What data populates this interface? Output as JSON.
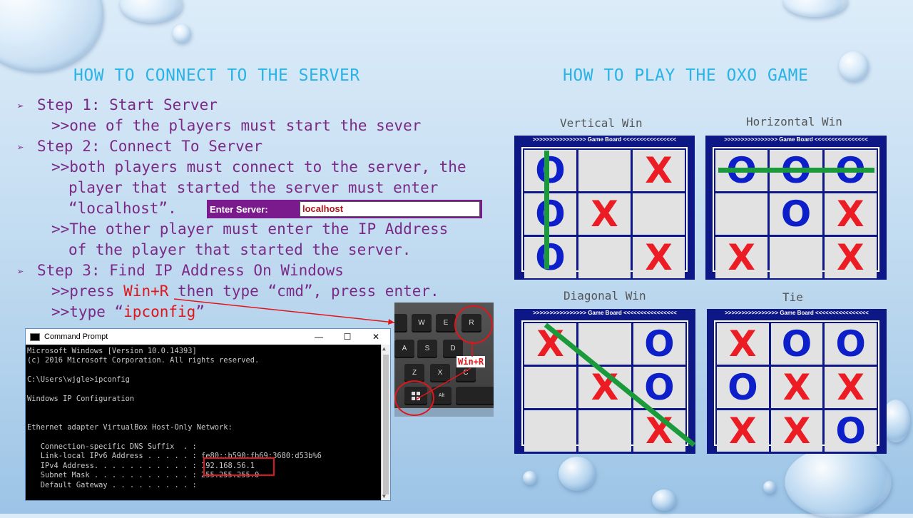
{
  "headings": {
    "connect": "HOW TO CONNECT TO THE SERVER",
    "play": "HOW TO PLAY THE OXO GAME"
  },
  "steps": {
    "bullet": "➢",
    "step1": "Step 1: Start Server",
    "step1_detail": ">>one of the players must start the sever",
    "step2": "Step 2: Connect To Server",
    "step2_detail_1": ">>both players must connect to the server, the",
    "step2_detail_2": "player that started the server must enter",
    "step2_detail_3": "“localhost”.",
    "step2_detail_4": ">>The other player must enter the IP Address",
    "step2_detail_5": "of the player that started the server.",
    "step3": "Step 3: Find IP Address On Windows",
    "step3_press_pre": ">>press ",
    "step3_press_key": "Win+R",
    "step3_press_post": " then type “cmd”, press enter.",
    "step3_type_pre": ">>type “",
    "step3_type_cmd": "ipconfig",
    "step3_type_post": "”"
  },
  "enter_server": {
    "label": "Enter Server:",
    "value": "localhost"
  },
  "cmd": {
    "title": "Command Prompt",
    "controls": {
      "minimize": "—",
      "maximize": "☐",
      "close": "✕"
    },
    "lines": [
      "Microsoft Windows [Version 10.0.14393]",
      "(c) 2016 Microsoft Corporation. All rights reserved.",
      "",
      "C:\\Users\\wjgle>ipconfig",
      "",
      "Windows IP Configuration",
      "",
      "",
      "Ethernet adapter VirtualBox Host-Only Network:",
      "",
      "   Connection-specific DNS Suffix  . :",
      "   Link-local IPv6 Address . . . . . : fe80::b590:fb69:3680:d53b%6",
      "   IPv4 Address. . . . . . . . . . . : 192.168.56.1",
      "   Subnet Mask . . . . . . . . . . . : 255.255.255.0",
      "   Default Gateway . . . . . . . . . :"
    ]
  },
  "keyboard": {
    "keys": [
      "W",
      "E",
      "R",
      "A",
      "S",
      "D",
      "Z",
      "X",
      "C",
      "Alt"
    ],
    "callout": "Win+R"
  },
  "boards": [
    {
      "label": "Vertical Win",
      "header": ">>>>>>>>>>>>>>>> Game Board <<<<<<<<<<<<<<<<",
      "cells": [
        "O",
        "",
        "X",
        "O",
        "X",
        "",
        "O",
        "",
        "X"
      ]
    },
    {
      "label": "Horizontal Win",
      "header": ">>>>>>>>>>>>>>>> Game Board <<<<<<<<<<<<<<<<",
      "cells": [
        "O",
        "O",
        "O",
        "",
        "O",
        "X",
        "X",
        "",
        "X"
      ]
    },
    {
      "label": "Diagonal Win",
      "header": ">>>>>>>>>>>>>>>> Game Board <<<<<<<<<<<<<<<<",
      "cells": [
        "X",
        "",
        "O",
        "",
        "X",
        "O",
        "",
        "",
        "X"
      ]
    },
    {
      "label": "Tie",
      "header": ">>>>>>>>>>>>>>>> Game Board <<<<<<<<<<<<<<<<",
      "cells": [
        "X",
        "O",
        "O",
        "O",
        "X",
        "X",
        "X",
        "X",
        "O"
      ]
    }
  ]
}
